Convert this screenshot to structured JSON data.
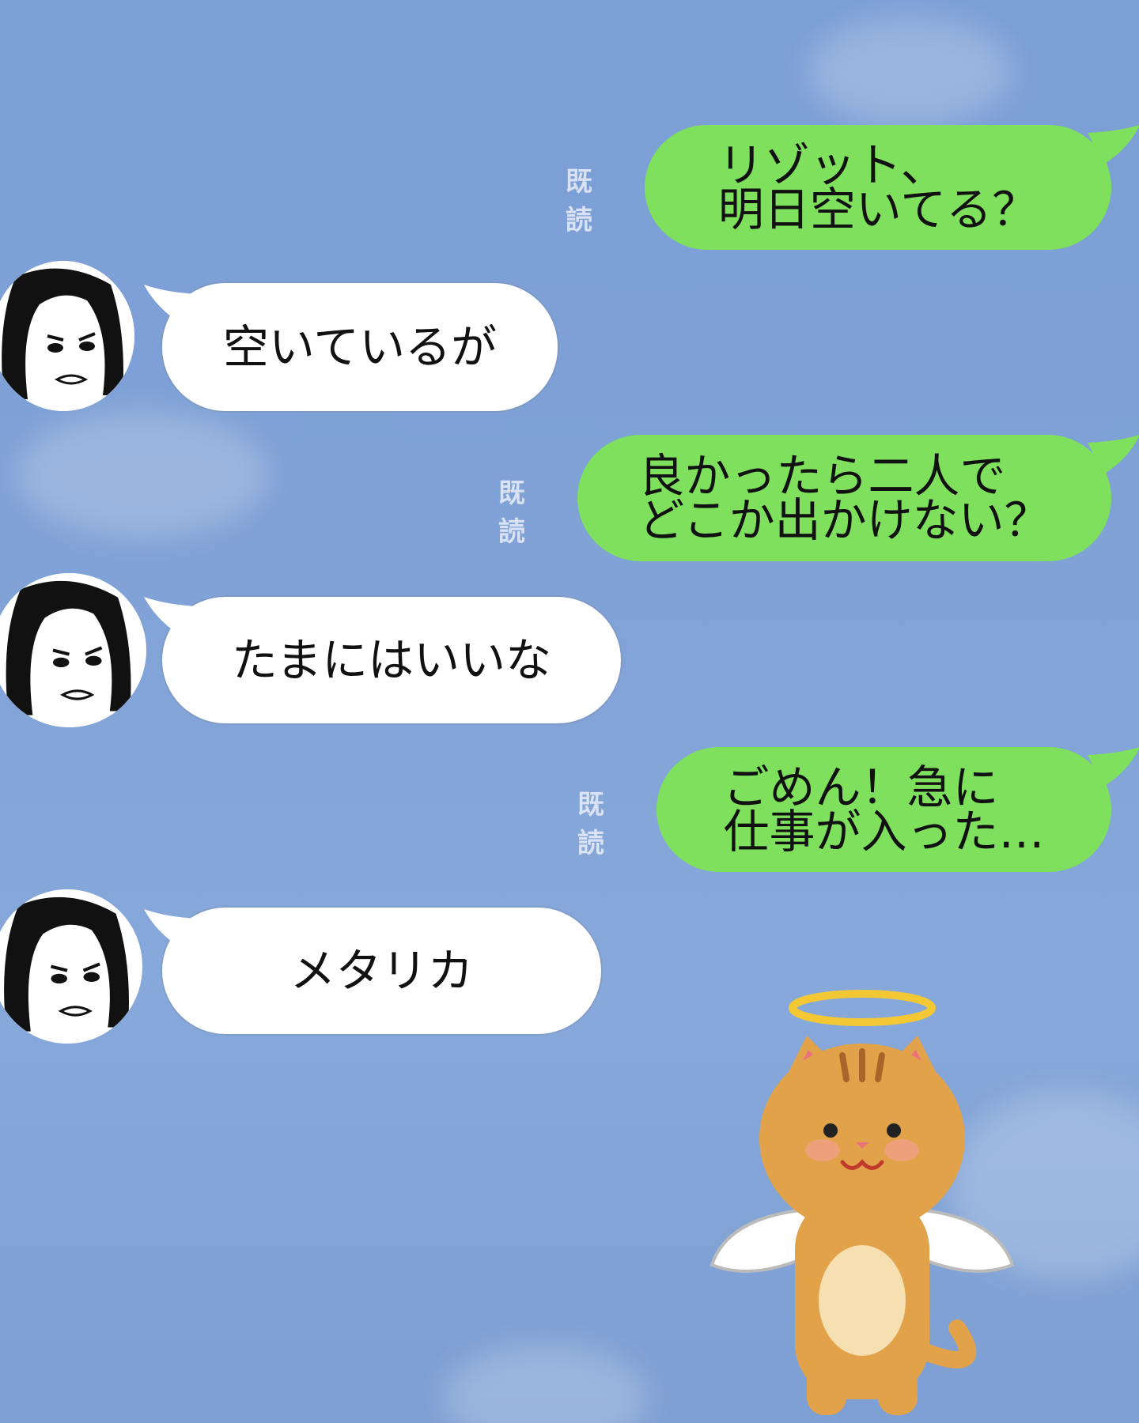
{
  "chat": {
    "messages": [
      {
        "side": "outgoing",
        "text": "リゾット、\n明日空いてる？",
        "read_label": "既読"
      },
      {
        "side": "incoming",
        "text": "空いているが"
      },
      {
        "side": "outgoing",
        "text": "良かったら二人で\nどこか出かけない？",
        "read_label": "既読"
      },
      {
        "side": "incoming",
        "text": "たまにはいいな"
      },
      {
        "side": "outgoing",
        "text": "ごめん！急に\n仕事が入った…",
        "read_label": "既読"
      },
      {
        "side": "incoming",
        "text": "メタリカ"
      }
    ]
  },
  "colors": {
    "background_sky": "#7fa1d6",
    "outgoing_bubble": "#7ee05c",
    "incoming_bubble": "#ffffff"
  },
  "icons": {
    "avatar": "sketched-face-avatar-icon",
    "sticker": "angel-cat-sticker-icon"
  }
}
